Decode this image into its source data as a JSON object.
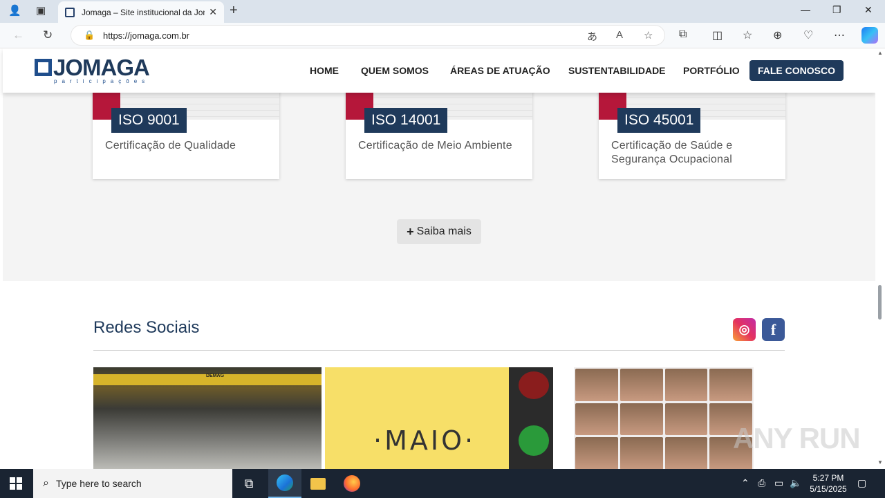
{
  "browser": {
    "tab_title": "Jomaga – Site institucional da Jomaga",
    "url": "https://jomaga.com.br"
  },
  "site": {
    "logo_text": "JOMAGA",
    "logo_sub": "participações",
    "nav": [
      "HOME",
      "QUEM SOMOS",
      "ÁREAS DE ATUAÇÃO",
      "SUSTENTABILIDADE",
      "PORTFÓLIO"
    ],
    "cta": "FALE CONOSCO"
  },
  "certifications": [
    {
      "badge": "ISO 9001",
      "text": "Certificação de Qualidade"
    },
    {
      "badge": "ISO 14001",
      "text": "Certificação de Meio Ambiente"
    },
    {
      "badge": "ISO 45001",
      "text": "Certificação de Saúde e Segurança Ocupacional"
    }
  ],
  "saiba_mais": "Saiba mais",
  "redes": {
    "title": "Redes Sociais",
    "post1_label": "DEMAG",
    "post2_text": "·MAIO·"
  },
  "watermark": "ANY RUN",
  "taskbar": {
    "search_placeholder": "Type here to search",
    "time": "5:27 PM",
    "date": "5/15/2025"
  }
}
